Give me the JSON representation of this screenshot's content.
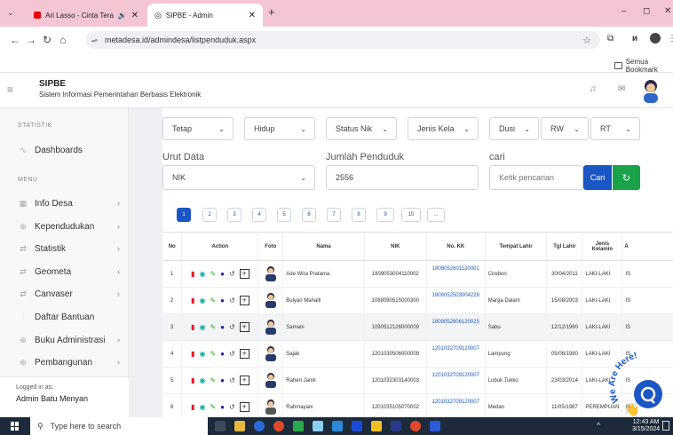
{
  "browser": {
    "tabs": [
      {
        "title": "Ari Lasso - Cinta Terakhir | ...",
        "active": false
      },
      {
        "title": "SIPBE - Admin",
        "active": true
      }
    ],
    "url": "metadesa.id/admindesa/listpenduduk.aspx",
    "bookmarks_label": "Semua Bookmark",
    "window_controls": [
      "–",
      "◻",
      "✕"
    ]
  },
  "header": {
    "app_name": "SIPBE",
    "app_subtitle": "Sistem Informasi Pemerintahan Berbasis Elektronik"
  },
  "sidebar": {
    "sections": [
      {
        "title": "STATISTIK",
        "items": [
          {
            "label": "Dashboards",
            "icon": "pulse-icon",
            "chevron": false
          }
        ]
      },
      {
        "title": "MENU",
        "items": [
          {
            "label": "Info Desa",
            "icon": "grid-icon",
            "chevron": true
          },
          {
            "label": "Kependudukan",
            "icon": "globe-icon",
            "chevron": true
          },
          {
            "label": "Statistik",
            "icon": "arrows-icon",
            "chevron": true
          },
          {
            "label": "Geometa",
            "icon": "arrows-icon",
            "chevron": true
          },
          {
            "label": "Canvaser",
            "icon": "arrows-icon",
            "chevron": true
          },
          {
            "label": "Daftar Bantuan",
            "icon": "bars-icon",
            "chevron": false
          },
          {
            "label": "Buku Administrasi",
            "icon": "globe-icon",
            "chevron": true
          },
          {
            "label": "Pembangunan",
            "icon": "globe-icon",
            "chevron": true
          }
        ]
      }
    ],
    "logged_in_label": "Logged in as:",
    "logged_in_user": "Admin Batu Menyan"
  },
  "filters": {
    "row1": [
      "Tetap",
      "Hidup",
      "Status Nik",
      "Jenis Kela",
      "Dusi",
      "RW",
      "RT"
    ],
    "urut_label": "Urut Data",
    "urut_value": "NIK",
    "jumlah_label": "Jumlah Penduduk",
    "jumlah_value": "2556",
    "cari_label": "cari",
    "cari_placeholder": "Ketik pencarian",
    "cari_button": "Cari",
    "refresh_icon": "refresh-icon"
  },
  "pagination": [
    "1",
    "2",
    "3",
    "4",
    "5",
    "6",
    "7",
    "8",
    "9",
    "10",
    "..."
  ],
  "table": {
    "headers": [
      "No",
      "Action",
      "Foto",
      "Nama",
      "NIK",
      "No. KK",
      "Tempat Lahir",
      "Tgl Lahir",
      "Jenis Kelamin",
      "A"
    ],
    "rows": [
      {
        "no": "1",
        "nama": "Ade Wira Pratama",
        "nik": "1809053004110002",
        "kk": "1809052601120001",
        "tempat": "Cirebon",
        "tgl": "30/04/2011",
        "jk": "LAKI-LAKI",
        "a": "IS",
        "gender": "m"
      },
      {
        "no": "2",
        "nama": "Bulyan Mahalli",
        "nik": "1088090515000300",
        "kk": "1809052503004228",
        "tempat": "Marga Dalam",
        "tgl": "15/08/2003",
        "jk": "LAKI-LAKI",
        "a": "IS",
        "gender": "m"
      },
      {
        "no": "3",
        "nama": "Samani",
        "nik": "1090512126000009",
        "kk": "1809052806120025",
        "tempat": "Sabu",
        "tgl": "12/12/1960",
        "jk": "LAKI-LAKI",
        "a": "IS",
        "gender": "m"
      },
      {
        "no": "4",
        "nama": "Sajak",
        "nik": "1201030506000009",
        "kk": "1201032709120007",
        "tempat": "Lampung",
        "tgl": "05/06/1980",
        "jk": "LAKI-LAKI",
        "a": "IS",
        "gender": "m"
      },
      {
        "no": "5",
        "nama": "Rahen Jamil",
        "nik": "1201032303140003",
        "kk": "1201032709120007",
        "tempat": "Lubuk Tukko",
        "tgl": "23/03/2014",
        "jk": "LAKI-LAKI",
        "a": "IS",
        "gender": "m"
      },
      {
        "no": "6",
        "nama": "Rahmayani",
        "nik": "1201035105070002",
        "kk": "1201032709120007",
        "tempat": "Medan",
        "tgl": "11/05/1987",
        "jk": "PEREMPUAN",
        "a": "IS",
        "gender": "f"
      }
    ]
  },
  "chat_widget": {
    "text": "We Are Here!"
  },
  "taskbar": {
    "search_placeholder": "Type here to search",
    "time": "12:43 AM",
    "date": "3/15/2024"
  },
  "colors": {
    "primary": "#1a56c4",
    "success": "#1aa34a",
    "tabbar": "#f4c6d4",
    "taskbar": "#1c2a3a"
  }
}
